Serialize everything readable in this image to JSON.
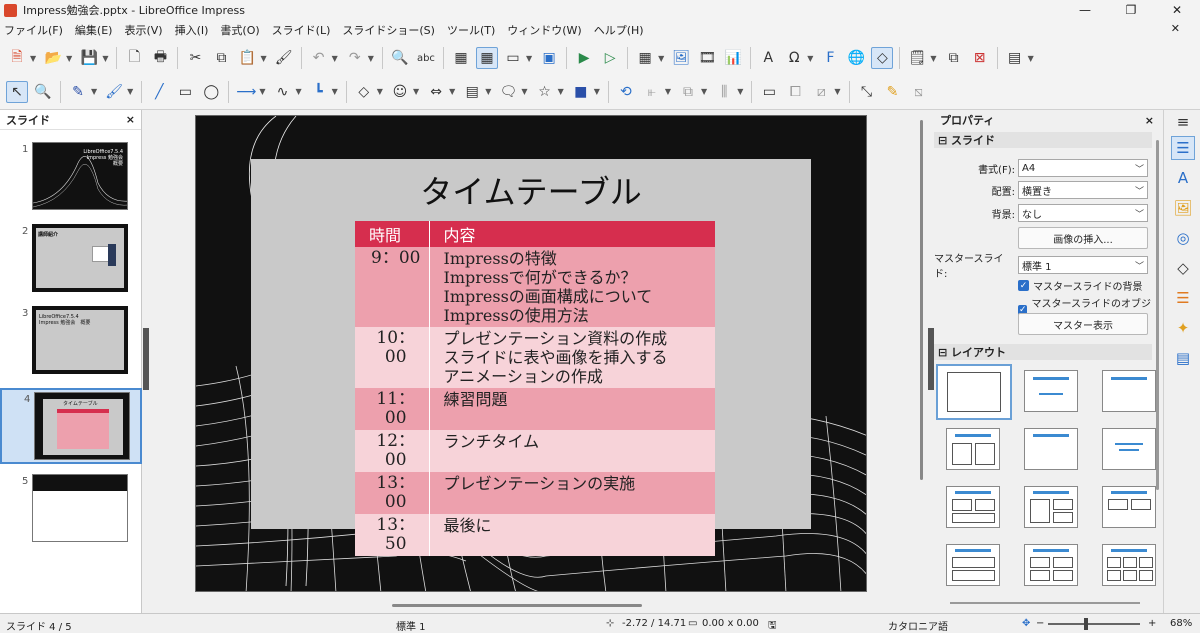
{
  "window": {
    "title": "Impress勉強会.pptx - LibreOffice Impress",
    "min": "—",
    "max": "❐",
    "close": "✕"
  },
  "menu": [
    "ファイル(F)",
    "編集(E)",
    "表示(V)",
    "挿入(I)",
    "書式(O)",
    "スライド(L)",
    "スライドショー(S)",
    "ツール(T)",
    "ウィンドウ(W)",
    "ヘルプ(H)"
  ],
  "slide_pane": {
    "title": "スライド",
    "close": "×",
    "thumbs": [
      {
        "num": "1",
        "text": "LibreOffice7.5.4\nImpress 勉強会\n概要"
      },
      {
        "num": "2",
        "text": "講師紹介"
      },
      {
        "num": "3",
        "text": "LibreOffice7.5.4\nImpress 勉強会　概要"
      },
      {
        "num": "4",
        "text": "タイムテーブル"
      },
      {
        "num": "5",
        "text": ""
      }
    ]
  },
  "slide": {
    "title": "タイムテーブル",
    "header": [
      "時間",
      "内容"
    ],
    "rows": [
      {
        "time": "9：00",
        "content": [
          "Impressの特徴",
          "Impressで何ができるか？",
          "Impressの画面構成について",
          "Impressの使用方法"
        ],
        "style": "dark"
      },
      {
        "time": "10：00",
        "content": [
          "プレゼンテーション資料の作成",
          "スライドに表や画像を挿入する",
          "アニメーションの作成"
        ],
        "style": "light"
      },
      {
        "time": "11：00",
        "content": [
          "練習問題"
        ],
        "style": "dark"
      },
      {
        "time": "12：00",
        "content": [
          "ランチタイム"
        ],
        "style": "light"
      },
      {
        "time": "13：00",
        "content": [
          "プレゼンテーションの実施"
        ],
        "style": "dark"
      },
      {
        "time": "13：50",
        "content": [
          "最後に"
        ],
        "style": "light"
      }
    ]
  },
  "properties": {
    "title": "プロパティ",
    "close": "×",
    "menu": "≡",
    "slide_section": "スライド",
    "format_label": "書式(F):",
    "format_value": "A4",
    "orientation_label": "配置:",
    "orientation_value": "横置き",
    "background_label": "背景:",
    "background_value": "なし",
    "insert_image": "画像の挿入...",
    "master_label": "マスタースライド:",
    "master_value": "標準 1",
    "master_bg": "マスタースライドの背景",
    "master_obj": "マスタースライドのオブジェクト",
    "master_view": "マスター表示",
    "layout_section": "レイアウト"
  },
  "status": {
    "slide": "スライド 4 / 5",
    "master": "標準 1",
    "position": "-2.72 / 14.71",
    "size": "0.00 x 0.00",
    "language": "カタロニア語",
    "zoom_minus": "−",
    "zoom_plus": "+",
    "zoom": "68%"
  },
  "colors": {
    "header": "#d62e4e",
    "row_dark": "#eda0ad",
    "row_light": "#f7d3d9",
    "accent": "#2a6fc9"
  }
}
